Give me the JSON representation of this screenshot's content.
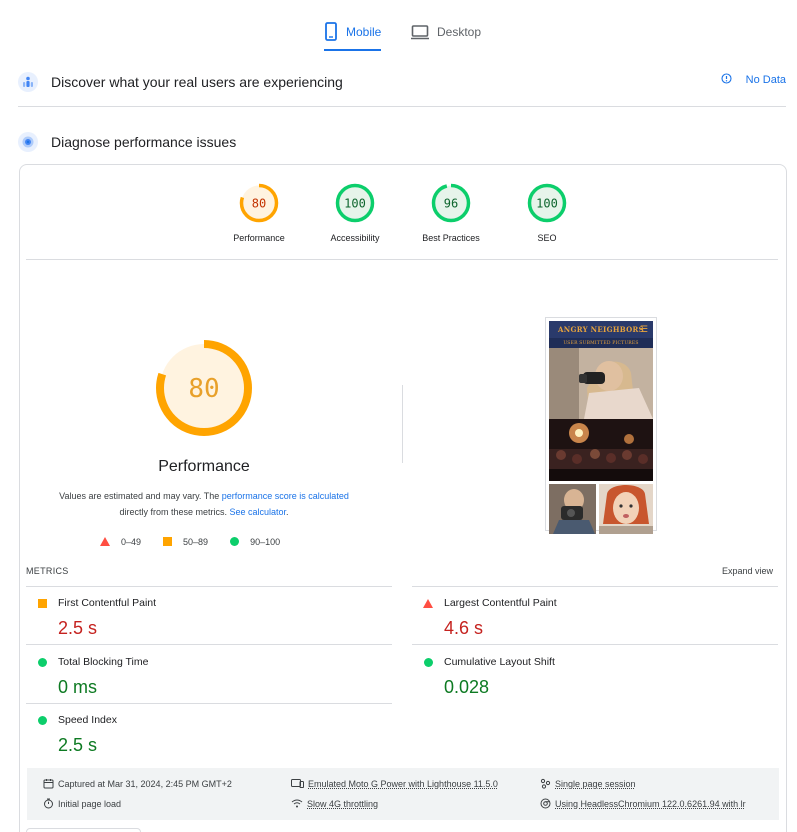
{
  "tabs": {
    "mobile": "Mobile",
    "desktop": "Desktop"
  },
  "real_users": {
    "title": "Discover what your real users are experiencing",
    "status": "No Data"
  },
  "diagnose": {
    "title": "Diagnose performance issues"
  },
  "categories": [
    {
      "score": "80",
      "label": "Performance",
      "fraction": 0.8,
      "color": "#ffa400"
    },
    {
      "score": "100",
      "label": "Accessibility",
      "fraction": 1.0,
      "color": "#0cce6b"
    },
    {
      "score": "96",
      "label": "Best Practices",
      "fraction": 0.96,
      "color": "#0cce6b"
    },
    {
      "score": "100",
      "label": "SEO",
      "fraction": 1.0,
      "color": "#0cce6b"
    }
  ],
  "main_gauge": {
    "score": "80",
    "label": "Performance",
    "fraction": 0.8
  },
  "note": {
    "t1": "Values are estimated and may vary. The ",
    "link1": "performance score is calculated",
    "t2": "directly from these metrics. ",
    "link2": "See calculator",
    "t3": "."
  },
  "legend": {
    "red": "0–49",
    "orange": "50–89",
    "green": "90–100"
  },
  "screenshot": {
    "logo": "ANGRY NEIGHBORS",
    "subtitle": "USER SUBMITTED PICTURES"
  },
  "metrics": {
    "header": "METRICS",
    "expand": "Expand view",
    "fcp": {
      "label": "First Contentful Paint",
      "value": "2.5 s"
    },
    "lcp": {
      "label": "Largest Contentful Paint",
      "value": "4.6 s"
    },
    "tbt": {
      "label": "Total Blocking Time",
      "value": "0 ms"
    },
    "cls": {
      "label": "Cumulative Layout Shift",
      "value": "0.028"
    },
    "si": {
      "label": "Speed Index",
      "value": "2.5 s"
    }
  },
  "footer": {
    "captured": "Captured at Mar 31, 2024, 2:45 PM GMT+2",
    "initial": "Initial page load",
    "emulated": "Emulated Moto G Power with Lighthouse 11.5.0",
    "throttling": "Slow 4G throttling",
    "session": "Single page session",
    "browser": "Using HeadlessChromium 122.0.6261.94 with lr"
  },
  "colors": {
    "accent": "#1a73e8",
    "pass": "#0cce6b",
    "average": "#ffa400",
    "fail": "#ff4e42"
  }
}
